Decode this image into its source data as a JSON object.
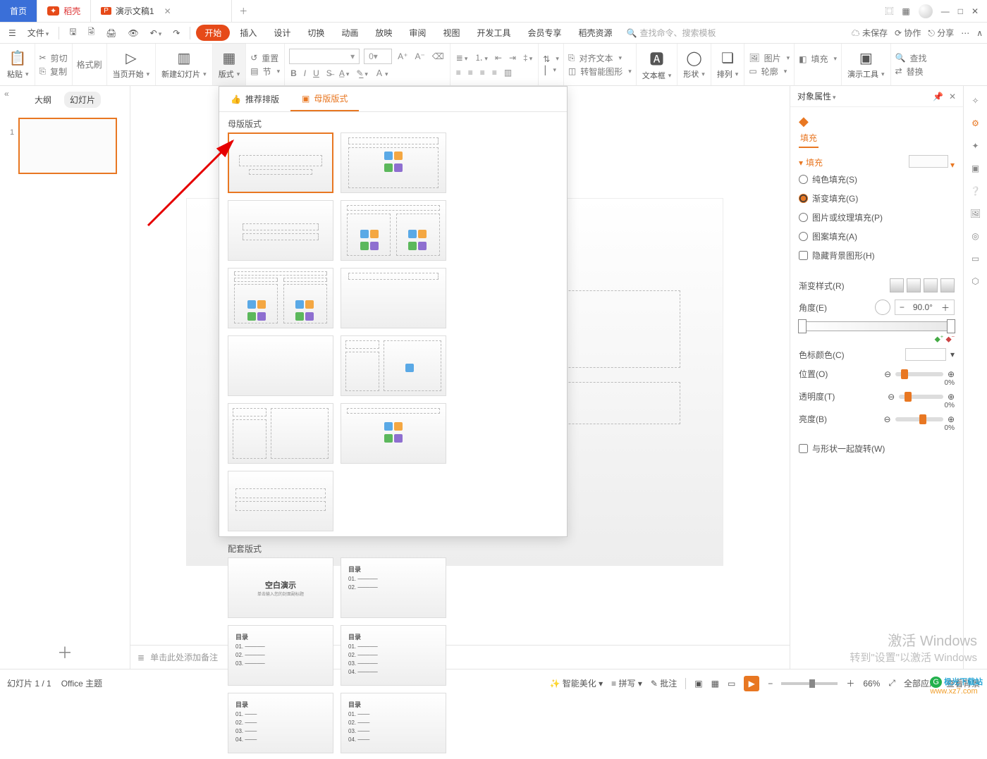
{
  "titlebar": {
    "tabs": [
      {
        "label": "首页",
        "kind": "home"
      },
      {
        "label": "稻壳",
        "kind": "docer"
      },
      {
        "label": "演示文稿1",
        "kind": "doc",
        "icon": "P"
      }
    ]
  },
  "window": {
    "grid": "▦",
    "avatar": "◐",
    "min": "—",
    "max": "□",
    "close": "✕",
    "layout": "⿴"
  },
  "menu": {
    "file": "文件",
    "tabs": [
      "开始",
      "插入",
      "设计",
      "切换",
      "动画",
      "放映",
      "审阅",
      "视图",
      "开发工具",
      "会员专享",
      "稻壳资源"
    ],
    "search_placeholder": "查找命令、搜索模板",
    "unsaved": "未保存",
    "coop": "协作",
    "share": "分享"
  },
  "ribbon": {
    "paste": "粘贴",
    "cut": "剪切",
    "copy": "复制",
    "format_painter": "格式刷",
    "from_current": "当页开始",
    "new_slide": "新建幻灯片",
    "layout_btn": "版式",
    "reset": "重置",
    "section": "节",
    "font_size_ph": "0",
    "align_text": "对齐文本",
    "smart_shape": "转智能图形",
    "textbox": "文本框",
    "shape": "形状",
    "arrange": "排列",
    "picture": "图片",
    "fill": "填充",
    "outline": "轮廓",
    "present_tools": "演示工具",
    "find": "查找",
    "replace": "替换"
  },
  "left": {
    "outline": "大纲",
    "slides": "幻灯片",
    "num": "1"
  },
  "drop": {
    "tab_recommend": "推荐排版",
    "tab_master": "母版版式",
    "section_master": "母版版式",
    "section_suite": "配套版式",
    "suite1_title": "空白演示",
    "suite1_sub": "单击输入您的封面副标题",
    "toc": "目录"
  },
  "rpanel": {
    "title": "对象属性",
    "fill_tab": "填充",
    "fill_section": "填充",
    "solid": "纯色填充(S)",
    "gradient": "渐变填充(G)",
    "pic": "图片或纹理填充(P)",
    "pattern": "图案填充(A)",
    "hidebg": "隐藏背景图形(H)",
    "grad_style": "渐变样式(R)",
    "angle": "角度(E)",
    "angle_val": "90.0°",
    "stop_color": "色标颜色(C)",
    "position": "位置(O)",
    "opacity": "透明度(T)",
    "brightness": "亮度(B)",
    "pct": "0%",
    "rotate": "与形状一起旋转(W)"
  },
  "notes": {
    "placeholder": "单击此处添加备注"
  },
  "status": {
    "slide": "幻灯片 1 / 1",
    "theme": "Office 主题",
    "beautify": "智能美化",
    "spell": "拼写",
    "comment": "批注",
    "all_apps": "全部应用",
    "check_bg": "查看背景",
    "zoom": "66%"
  },
  "wm": {
    "l1": "激活 Windows",
    "l2": "转到\"设置\"以激活 Windows"
  },
  "logo": {
    "brand": "极光下载站",
    "url": "www.xz7.com"
  }
}
